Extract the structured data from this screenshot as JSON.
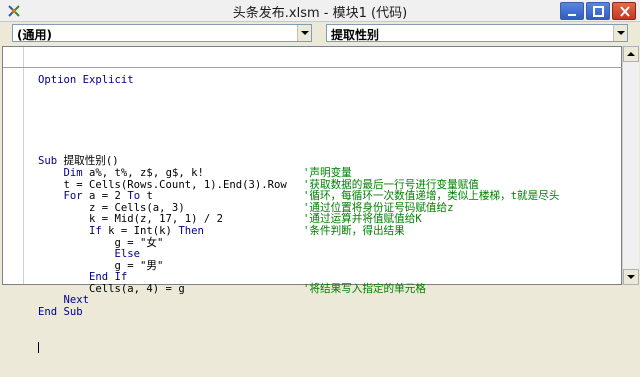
{
  "window": {
    "title": "头条发布.xlsm - 模块1 (代码)"
  },
  "dropdowns": {
    "object": "(通用)",
    "procedure": "提取性别"
  },
  "colors": {
    "keyword": "#00008b",
    "comment": "#008000",
    "code": "#000000"
  },
  "icons": {
    "app": "vba-editor-icon",
    "minimize": "minimize-icon",
    "maximize": "maximize-icon",
    "close": "close-icon"
  },
  "code": {
    "option_explicit": "Option Explicit",
    "lines": [
      {
        "kw": "Sub",
        "text": " 提取性别()",
        "comment": ""
      },
      {
        "kw": "    Dim",
        "text": " a%, t%, z$, g$, k!",
        "comment": "'声明变量"
      },
      {
        "kw": "",
        "text": "    t = Cells(Rows.Count, 1).End(3).Row",
        "comment": "'获取数据的最后一行号进行变量赋值"
      },
      {
        "kw": "    For",
        "text": " a = 2 ",
        "kw2": "To",
        "text2": " t",
        "comment": "'循环，每循环一次数值递增，类似上楼梯，t就是尽头"
      },
      {
        "kw": "",
        "text": "        z = Cells(a, 3)",
        "comment": "'通过位置将身份证号码赋值给z"
      },
      {
        "kw": "",
        "text": "        k = Mid(z, 17, 1) / 2",
        "comment": "'通过运算并将值赋值给K"
      },
      {
        "kw": "        If",
        "text": " k = Int(k) ",
        "kw2": "Then",
        "text2": "",
        "comment": "'条件判断，得出结果"
      },
      {
        "kw": "",
        "text": "            g = \"女\"",
        "comment": ""
      },
      {
        "kw": "            Else",
        "text": "",
        "comment": ""
      },
      {
        "kw": "",
        "text": "            g = \"男\"",
        "comment": ""
      },
      {
        "kw": "        End If",
        "text": "",
        "comment": ""
      },
      {
        "kw": "",
        "text": "        Cells(a, 4) = g",
        "comment": "'将结果写入指定的单元格"
      },
      {
        "kw": "    Next",
        "text": "",
        "comment": ""
      },
      {
        "kw": "End Sub",
        "text": "",
        "comment": ""
      }
    ]
  }
}
